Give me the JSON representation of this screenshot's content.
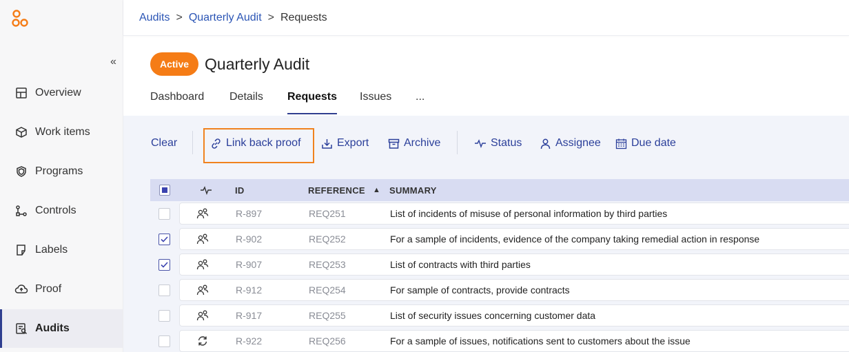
{
  "breadcrumb": {
    "items": [
      "Audits",
      "Quarterly Audit"
    ],
    "separator": ">",
    "current": "Requests"
  },
  "header": {
    "status_badge": "Active",
    "title": "Quarterly Audit"
  },
  "sidebar": {
    "collapse_label": "«",
    "items": [
      {
        "label": "Overview",
        "icon": "overview-icon"
      },
      {
        "label": "Work items",
        "icon": "box-icon"
      },
      {
        "label": "Programs",
        "icon": "shield-icon"
      },
      {
        "label": "Controls",
        "icon": "controls-icon"
      },
      {
        "label": "Labels",
        "icon": "label-icon"
      },
      {
        "label": "Proof",
        "icon": "cloud-upload-icon"
      },
      {
        "label": "Audits",
        "icon": "audit-icon",
        "active": true
      }
    ]
  },
  "tabs": [
    {
      "label": "Dashboard"
    },
    {
      "label": "Details"
    },
    {
      "label": "Requests",
      "active": true
    },
    {
      "label": "Issues"
    },
    {
      "label": "..."
    }
  ],
  "toolbar": {
    "clear": "Clear",
    "link_back_proof": "Link back proof",
    "export": "Export",
    "archive": "Archive",
    "status": "Status",
    "assignee": "Assignee",
    "due_date": "Due date"
  },
  "table": {
    "columns": {
      "id": "ID",
      "reference": "REFERENCE",
      "summary": "SUMMARY"
    },
    "sort_indicator": "▲",
    "rows": [
      {
        "id": "R-897",
        "reference": "REQ251",
        "summary": "List of incidents of misuse of personal information by third parties",
        "checked": false,
        "status_icon": "assignee-icon"
      },
      {
        "id": "R-902",
        "reference": "REQ252",
        "summary": "For a sample of incidents, evidence of the company taking remedial action in response",
        "checked": true,
        "status_icon": "assignee-icon"
      },
      {
        "id": "R-907",
        "reference": "REQ253",
        "summary": "List of contracts with third parties",
        "checked": true,
        "status_icon": "assignee-icon"
      },
      {
        "id": "R-912",
        "reference": "REQ254",
        "summary": "For sample of contracts, provide contracts",
        "checked": false,
        "status_icon": "assignee-icon"
      },
      {
        "id": "R-917",
        "reference": "REQ255",
        "summary": "List of security issues concerning customer data",
        "checked": false,
        "status_icon": "assignee-icon"
      },
      {
        "id": "R-922",
        "reference": "REQ256",
        "summary": "For a sample of issues, notifications sent to customers about the issue",
        "checked": false,
        "status_icon": "refresh-icon"
      }
    ]
  },
  "colors": {
    "accent_orange": "#f57c16",
    "link_blue": "#2b55b5",
    "toolbar_blue": "#2b3f9a",
    "header_row": "#d8dcf2"
  }
}
